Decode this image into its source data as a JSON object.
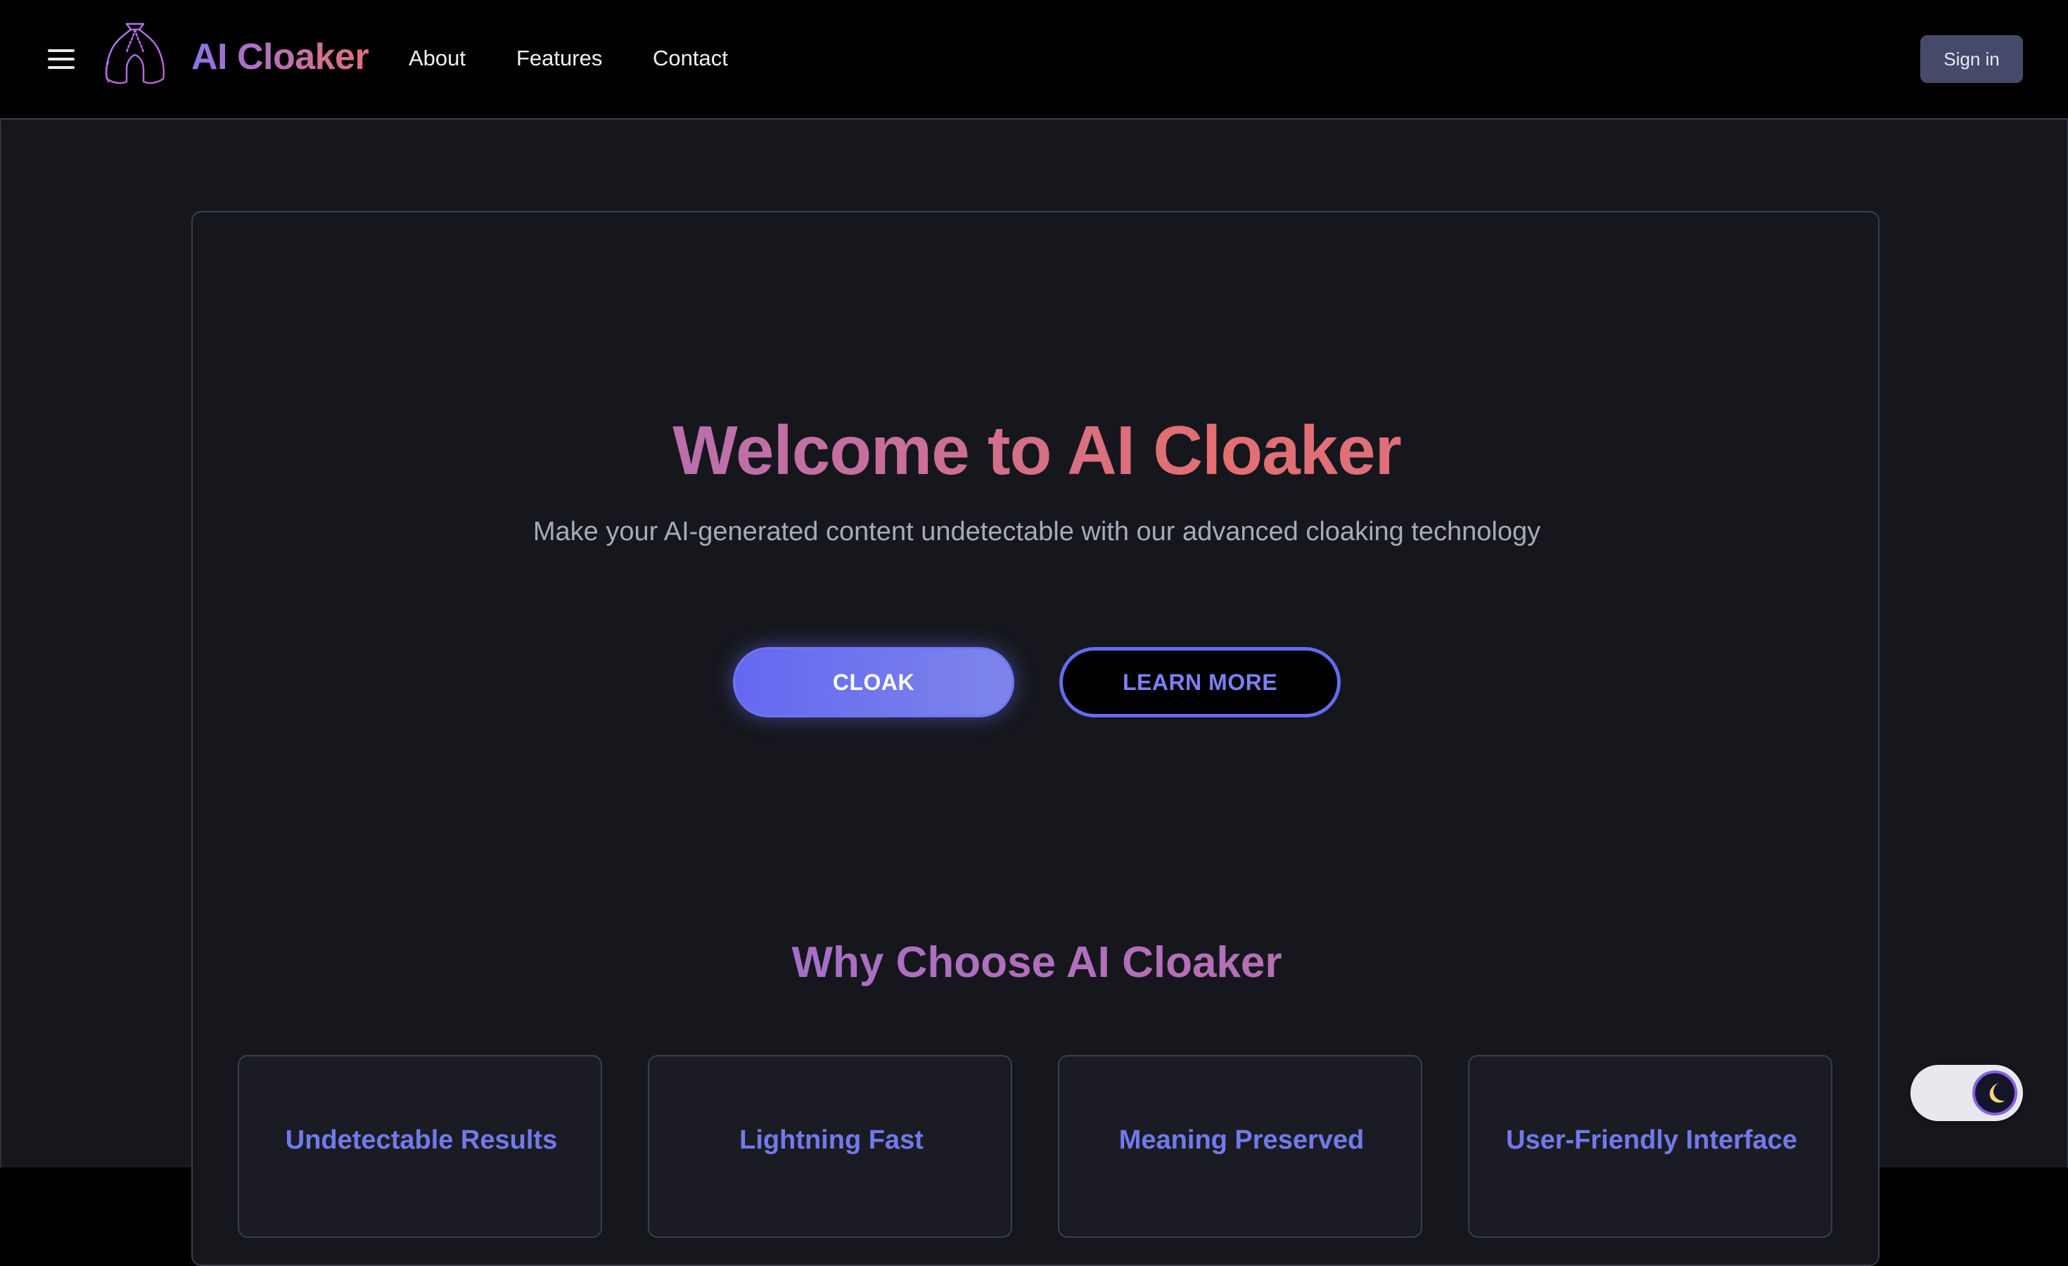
{
  "header": {
    "brand": "AI Cloaker",
    "nav": [
      "About",
      "Features",
      "Contact"
    ],
    "signin_label": "Sign in"
  },
  "hero": {
    "title": "Welcome to AI Cloaker",
    "subtitle": "Make your AI-generated content undetectable with our advanced cloaking technology",
    "primary_button": "CLOAK",
    "secondary_button": "LEARN MORE"
  },
  "features": {
    "title": "Why Choose AI Cloaker",
    "cards": [
      {
        "title": "Undetectable Results"
      },
      {
        "title": "Lightning Fast"
      },
      {
        "title": "Meaning Preserved"
      },
      {
        "title": "User-Friendly Interface"
      }
    ]
  },
  "theme_toggle": {
    "mode": "dark",
    "icon": "moon-icon"
  },
  "colors": {
    "accent": "#6468f1",
    "brand_gradient_start": "#8b73e6",
    "brand_gradient_end": "#e36f7e",
    "signin_bg": "#454a6b",
    "page_bg": "#16171d"
  }
}
